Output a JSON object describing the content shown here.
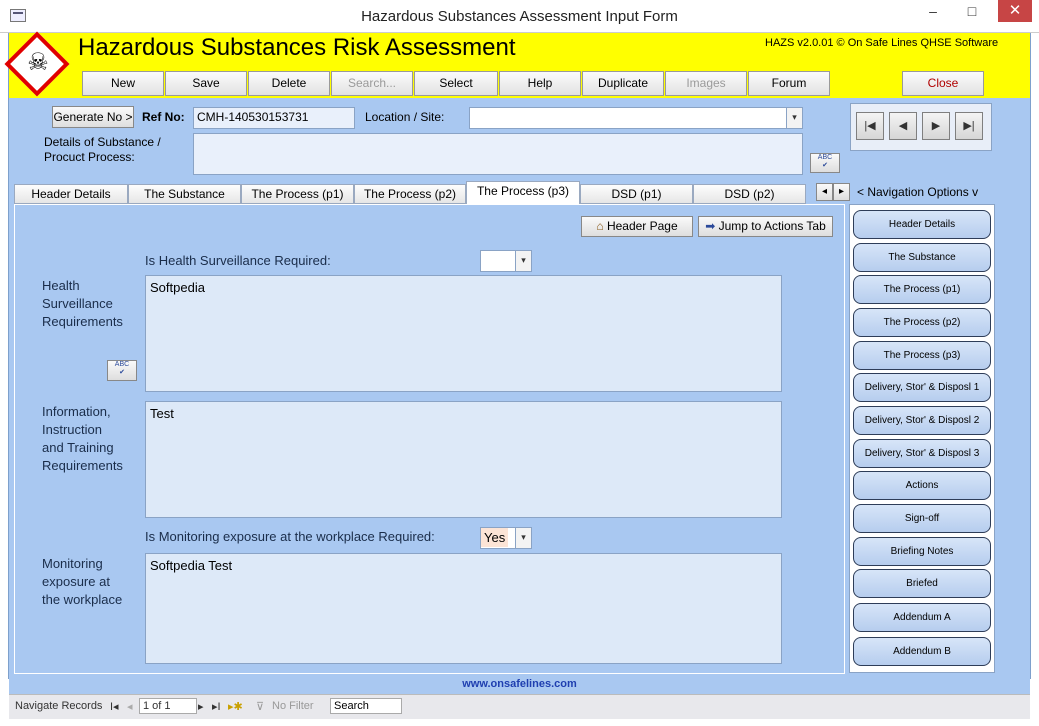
{
  "window": {
    "title": "Hazardous Substances Assessment Input Form",
    "minimize": "–",
    "maximize": "□",
    "close": "✕"
  },
  "header": {
    "app_title": "Hazardous Substances Risk Assessment",
    "version": "HAZS v2.0.01 © On Safe Lines QHSE Software",
    "logo_icon": "skull-hazard-icon"
  },
  "toolbar": {
    "new": "New",
    "save": "Save",
    "delete": "Delete",
    "search": "Search...",
    "select": "Select",
    "help": "Help",
    "duplicate": "Duplicate",
    "images": "Images",
    "forum": "Forum",
    "close": "Close"
  },
  "form": {
    "generate_btn": "Generate No >",
    "ref_label": "Ref No:",
    "ref_value": "CMH-140530153731",
    "location_label": "Location / Site:",
    "location_value": "",
    "details_label_1": "Details of Substance /",
    "details_label_2": "Procuct Process:",
    "details_value": ""
  },
  "tabs": [
    "Header Details",
    "The Substance",
    "The Process (p1)",
    "The Process (p2)",
    "The Process (p3)",
    "DSD (p1)",
    "DSD (p2)"
  ],
  "tab_scroll": {
    "left": "◂",
    "right": "▸"
  },
  "nav_options_label": "< Navigation Options v",
  "panel": {
    "header_page_btn": "Header Page",
    "jump_btn": "Jump to Actions Tab",
    "health_q": "Is Health Surveillance Required:",
    "health_q_value": "",
    "health_label": [
      "Health",
      "Surveillance",
      "Requirements"
    ],
    "health_text": "Softpedia",
    "info_label": [
      "Information,",
      "Instruction",
      "and Training",
      "Requirements"
    ],
    "info_text": "Test",
    "monitor_q": "Is Monitoring exposure at the workplace Required:",
    "monitor_q_value": "Yes",
    "monitor_label": [
      "Monitoring",
      "exposure at",
      "the workplace"
    ],
    "monitor_text": "Softpedia Test",
    "spell_icon": "ABC"
  },
  "sidenav": [
    "Header Details",
    "The Substance",
    "The Process (p1)",
    "The Process (p2)",
    "The Process (p3)",
    "Delivery, Stor' & Disposl 1",
    "Delivery, Stor' & Disposl 2",
    "Delivery, Stor' & Disposl 3",
    "Actions",
    "Sign-off",
    "Briefing Notes",
    "Briefed",
    "Addendum A",
    "Addendum B"
  ],
  "footer": {
    "url": "www.onsafelines.com"
  },
  "status": {
    "navigate": "Navigate Records",
    "record": "1 of 1",
    "filter": "No Filter",
    "search": "Search"
  },
  "colors": {
    "banner": "#ffff00",
    "form_bg": "#a9c8f1",
    "close_red": "#c74545",
    "link_blue": "#1f3fb0"
  }
}
